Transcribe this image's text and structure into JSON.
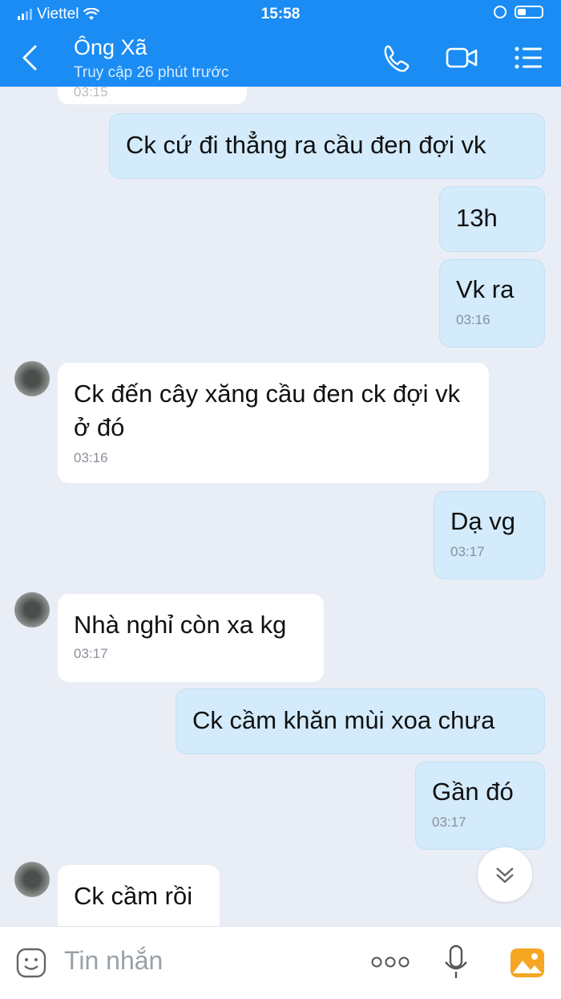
{
  "status_bar": {
    "carrier": "Viettel",
    "time": "15:58"
  },
  "header": {
    "contact_name": "Ông Xã",
    "last_seen": "Truy cập 26 phút trước"
  },
  "icons": {
    "back": "chevron-left-icon",
    "call": "phone-icon",
    "video": "video-camera-icon",
    "menu": "list-menu-icon",
    "scroll_down": "double-chevron-down-icon",
    "sticker": "sticker-icon",
    "more": "more-dots-icon",
    "mic": "microphone-icon",
    "image": "image-icon"
  },
  "colors": {
    "header_bg": "#1a8cf4",
    "sent_bubble": "#d3ebfb",
    "received_bubble": "#ffffff",
    "chat_bg": "#e9edf5"
  },
  "messages": [
    {
      "side": "received",
      "text": "",
      "time": "03:15"
    },
    {
      "side": "sent",
      "text": "Ck cứ đi thẳng ra cầu đen đợi vk",
      "time": ""
    },
    {
      "side": "sent",
      "text": "13h",
      "time": ""
    },
    {
      "side": "sent",
      "text": "Vk ra",
      "time": "03:16"
    },
    {
      "side": "received",
      "text": "Ck đến cây xăng cầu đen ck đợi vk ở đó",
      "time": "03:16"
    },
    {
      "side": "sent",
      "text": "Dạ vg",
      "time": "03:17"
    },
    {
      "side": "received",
      "text": "Nhà nghỉ còn xa kg",
      "time": "03:17"
    },
    {
      "side": "sent",
      "text": "Ck cầm khăn mùi xoa chưa",
      "time": ""
    },
    {
      "side": "sent",
      "text": "Gần đó",
      "time": "03:17"
    },
    {
      "side": "received",
      "text": "Ck cầm rồi",
      "time": ""
    }
  ],
  "composer": {
    "placeholder": "Tin nhắn"
  }
}
